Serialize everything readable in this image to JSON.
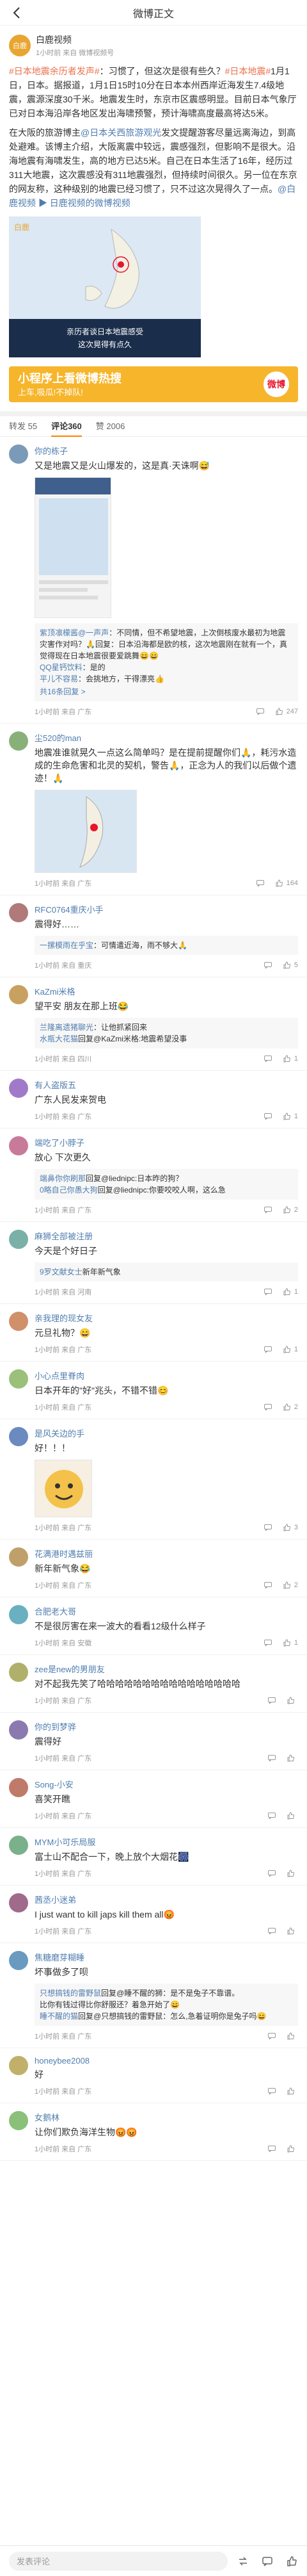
{
  "header": {
    "title": "微博正文"
  },
  "post": {
    "author": "白鹿视频",
    "avatar_text": "白鹿",
    "meta": "1小时前 来自 微博视频号",
    "tag1": "#日本地震余历者发声#",
    "text1": "：习惯了，但这次是很有些久？",
    "tag2": "#日本地震#",
    "text2": "1月1日，日本。据报道，1月1日15时10分在日本本州西岸近海发生7.4级地震，震源深度30千米。地震发生时，东京市区震感明显。目前日本气象厅已对日本海沿岸各地区发出海啸预警，预计海啸高度最高将达5米。",
    "text3": "在大阪的旅游博主",
    "mention": "@日本关西旅游观光",
    "text4": "发文提醒游客尽量远离海边，到高处避难。该博主介绍，大阪离震中较远，震感强烈，但影响不是很大。沿海地震有海啸发生，高的地方已达5米。自己在日本生活了16年，经历过311大地震，这次震感没有311地震强烈，但持续时间很久。另一位在东京的网友称，这种级别的地震已经习惯了，只不过这次晃得久了一点。",
    "mention2": "@白鹿视频",
    "link": "日鹿视频的微博视频",
    "video_logo": "白鹿",
    "video_caption1": "亲历者谈日本地震感受",
    "video_caption2": "这次晃得有点久"
  },
  "banner": {
    "line1": "小程序上看微博热搜",
    "line2": "上车,吸瓜!不掉队!",
    "logo": "微博"
  },
  "tabs": [
    {
      "label": "转发 55"
    },
    {
      "label": "评论360"
    },
    {
      "label": "赞 2006"
    }
  ],
  "comments": [
    {
      "name": "你的栋子",
      "text": "又是地震又是火山爆发的，这是真·天诛啊😅",
      "color": "#7a9ab8",
      "image": "screenshot",
      "replies": [
        {
          "name": "紫顶凛檬酱@一声声",
          "text": "：不同情，但不希望地震，上次倒核废水最初为地震灾害作对吗？🙏回复：日本沿海都是欧的核，这次地震刚在就有一个，真觉得现在日本地震很要爱跳舞😄😄"
        },
        {
          "name": "QQ星钙饮料",
          "text": "：是的"
        },
        {
          "name": "平儿不容易",
          "text": "：会挑地方，干得漂亮👍"
        }
      ],
      "more": "共16条回复 >",
      "time": "1小时前 来自 广东",
      "likes": "247"
    },
    {
      "name": "尘520的man",
      "text": "地震准谁就晃久一点这么简单吗？是在提前提醒你们🙏，耗污水造成的生命危害和北灵的契机，警告🙏，正念为人的我们以后做个遗迹！🙏",
      "color": "#8ab07a",
      "image": "map",
      "time": "1小时前 来自 广东",
      "likes": "164"
    },
    {
      "name": "RFC0764重庆小手",
      "text": "震得好……",
      "color": "#b07a7a",
      "replies": [
        {
          "name": "一摞模雨在乎宝",
          "text": "：可情遣近海，雨不够大🙏"
        }
      ],
      "time": "1小时前 来自 重庆",
      "likes": "5"
    },
    {
      "name": "KaZmi米格",
      "text": "望平安 朋友在那上班😂",
      "color": "#c8a060",
      "replies": [
        {
          "name": "兰隆离遗猪聊光",
          "text": "：让他抓紧回来"
        },
        {
          "name": "水瓶大花猫",
          "text": "回复@KaZmi米格:地震希望没事"
        }
      ],
      "time": "1小时前 来自 四川",
      "likes": "1"
    },
    {
      "name": "有人盗版五",
      "text": "广东人民发来贺电",
      "color": "#a07ac8",
      "time": "1小时前 来自 广东",
      "likes": "1"
    },
    {
      "name": "端吃了小脖子",
      "text": "放心 下次更久",
      "color": "#c87a9a",
      "replies": [
        {
          "name": "端鼻你你刷那",
          "text": "回复@liednipc:日本昨的狗？"
        },
        {
          "name": "0略自己你愚大狗",
          "text": "回复@liednipc:你要咬咬人啊，这么急"
        }
      ],
      "time": "1小时前 来自 广东",
      "likes": "2"
    },
    {
      "name": "麻狮全部被注册",
      "text": "今天是个好日子",
      "color": "#7ab0a8",
      "replies": [
        {
          "name": "9罗文献女士",
          "text": "新年新气象"
        }
      ],
      "time": "1小时前 来自 河南",
      "likes": "1"
    },
    {
      "name": "亲我理的现女友",
      "text": "元旦礼物？😄",
      "color": "#d0906a",
      "time": "1小时前 来自 广东",
      "likes": "1"
    },
    {
      "name": "小心点里脊肉",
      "text": "日本开年的\"好\"兆头，不错不错😊",
      "color": "#9ac07a",
      "time": "1小时前 来自 广东",
      "likes": "2"
    },
    {
      "name": "是风关边的手",
      "text": "好！！！",
      "color": "#6a8ac0",
      "image": "meme",
      "time": "1小时前 来自 广东",
      "likes": "3"
    },
    {
      "name": "花满港时遇兹丽",
      "text": "新年新气象😂",
      "color": "#c0a06a",
      "time": "1小时前 来自 广东",
      "likes": "2"
    },
    {
      "name": "合肥老大哥",
      "text": "不是很厉害在来一波大的看看12级什么样子",
      "color": "#6ab0c0",
      "time": "1小时前 来自 安徽",
      "likes": "1"
    },
    {
      "name": "zee是new的男朋友",
      "text": "对不起我先笑了哈哈哈哈哈哈哈哈哈哈哈哈哈哈哈哈",
      "color": "#b0b06a",
      "time": "1小时前 来自 广东",
      "likes": ""
    },
    {
      "name": "你的到梦骅",
      "text": "震得好",
      "color": "#8a7ab0",
      "time": "1小时前 来自 广东",
      "likes": ""
    },
    {
      "name": "Song-小安",
      "text": "喜笑开瞧",
      "color": "#c07a6a",
      "time": "1小时前 来自 广东",
      "likes": ""
    },
    {
      "name": "MYM小可乐局服",
      "text": "富士山不配合一下，晚上放个大烟花🎆",
      "color": "#7ab08a",
      "time": "1小时前 来自 广东",
      "likes": ""
    },
    {
      "name": "茜丞小迷弟",
      "text": "I just want to kill japs kill them all😡",
      "color": "#a06a8a",
      "time": "1小时前 来自 广东",
      "likes": ""
    },
    {
      "name": "焦糖磨芽糊睡",
      "text": "坏事做多了呗",
      "color": "#6a9ac0",
      "replies": [
        {
          "name": "只想搞钱的雷野鼠",
          "text": "回复@睡不醒的狮：是不是兔子不靠谱。"
        },
        {
          "name": "",
          "text": "比你有钱过得比你舒服还？着急开始了😄"
        },
        {
          "name": "睡不醒的猫",
          "text": "回复@只想搞钱的雷野鼠：怎么,急着证明你是兔子吗😄"
        }
      ],
      "time": "1小时前 来自 广东",
      "likes": ""
    },
    {
      "name": "honeybee2008",
      "text": "好",
      "color": "#c0b06a",
      "time": "1小时前 来自 广东",
      "likes": ""
    },
    {
      "name": "女鹅林",
      "text": "让你们欺负海洋生物😡😡",
      "color": "#8ac07a",
      "time": "1小时前 来自 广东",
      "likes": ""
    }
  ],
  "bottom": {
    "placeholder": "发表评论"
  }
}
